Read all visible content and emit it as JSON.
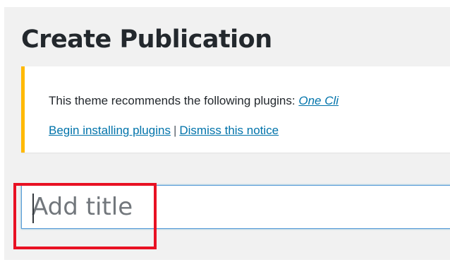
{
  "page": {
    "title": "Create Publication"
  },
  "notice": {
    "message_prefix": "This theme recommends the following plugins: ",
    "plugin_link": "One Cli",
    "begin_link": "Begin installing plugins",
    "separator": "|",
    "dismiss_link": "Dismiss this notice",
    "accent_color": "#ffb900"
  },
  "title_field": {
    "placeholder": "Add title",
    "value": ""
  },
  "annotation": {
    "highlight_color": "#e81123"
  }
}
